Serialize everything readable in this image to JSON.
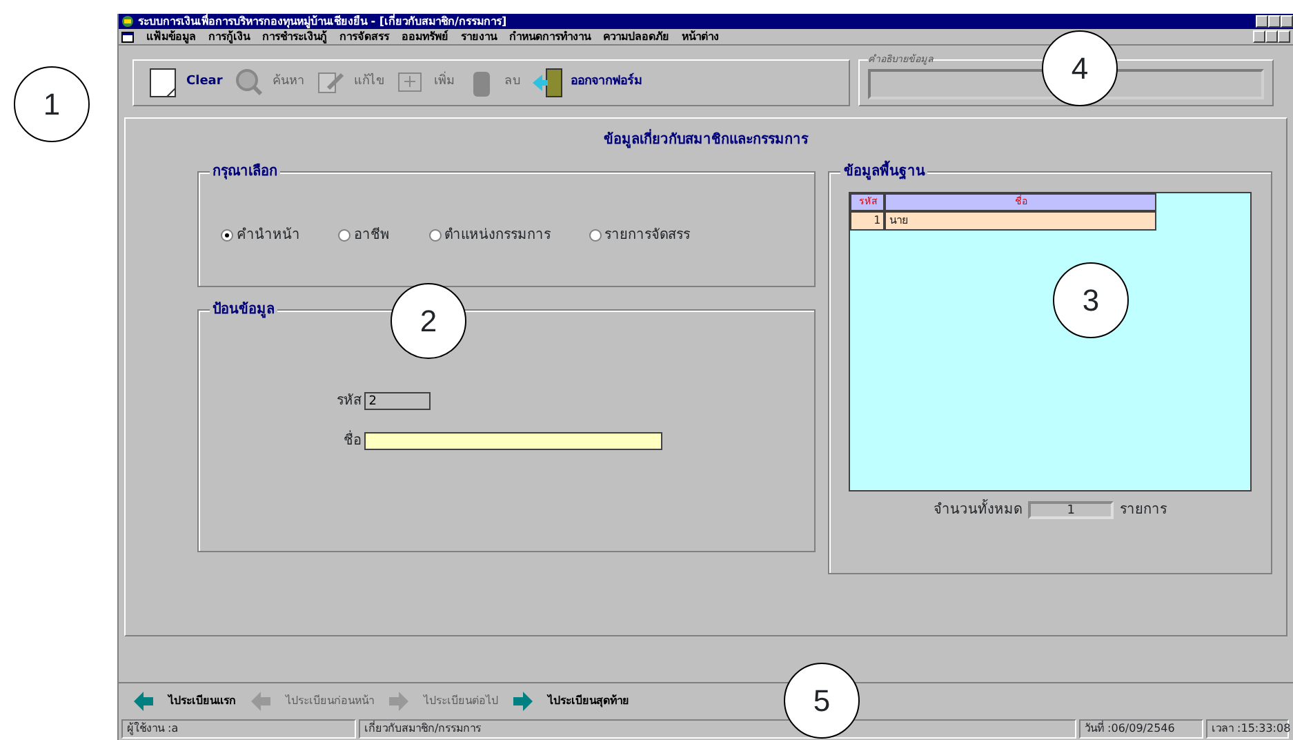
{
  "window": {
    "title": "ระบบการเงินเพื่อการบริหารกองทุนหมู่บ้านเชียงยืน - [เกี่ยวกับสมาชิก/กรรมการ]"
  },
  "menu": [
    "แฟ้มข้อมูล",
    "การกู้เงิน",
    "การชำระเงินกู้",
    "การจัดสรร",
    "ออมทรัพย์",
    "รายงาน",
    "กำหนดการทำงาน",
    "ความปลอดภัย",
    "หน้าต่าง"
  ],
  "toolbar": [
    {
      "kind": "clear",
      "label": "Clear",
      "disabled": false
    },
    {
      "kind": "search",
      "label": "ค้นหา",
      "disabled": true
    },
    {
      "kind": "edit",
      "label": "แก้ไข",
      "disabled": true
    },
    {
      "kind": "add",
      "label": "เพิ่ม",
      "disabled": true
    },
    {
      "kind": "delete",
      "label": "ลบ",
      "disabled": true
    },
    {
      "kind": "exit",
      "label": "ออกจากฟอร์ม",
      "disabled": false
    }
  ],
  "description_box": {
    "label": "คำอธิบายข้อมูล"
  },
  "heading": "ข้อมูลเกี่ยวกับสมาชิกและกรรมการ",
  "choice_group": {
    "title": "กรุณาเลือก",
    "options": [
      {
        "label": "คำนำหน้า",
        "selected": true
      },
      {
        "label": "อาชีพ",
        "selected": false
      },
      {
        "label": "ตำแหน่งกรรมการ",
        "selected": false
      },
      {
        "label": "รายการจัดสรร",
        "selected": false
      }
    ]
  },
  "input_group": {
    "title": "ป้อนข้อมูล",
    "fields": [
      {
        "label": "รหัส",
        "value": "2"
      },
      {
        "label": "ชื่อ"
      }
    ]
  },
  "data_group": {
    "title": "ข้อมูลพื้นฐาน",
    "columns": [
      "รหัส",
      "ชื่อ"
    ],
    "rows": [
      [
        "1",
        "นาย"
      ]
    ],
    "total_label": "จำนวนทั้งหมด",
    "total": "1",
    "unit": "รายการ"
  },
  "record_nav": [
    {
      "kind": "first",
      "label": "ไประเบียนแรก",
      "disabled": false
    },
    {
      "kind": "prev",
      "label": "ไประเบียนก่อนหน้า",
      "disabled": true
    },
    {
      "kind": "next",
      "label": "ไประเบียนต่อไป",
      "disabled": true
    },
    {
      "kind": "last",
      "label": "ไประเบียนสุดท้าย",
      "disabled": false
    }
  ],
  "status_bar": [
    "ผู้ใช้งาน :a",
    "เกี่ยวกับสมาชิก/กรรมการ",
    "วันที่ :06/09/2546",
    "เวลา :15:33:08"
  ],
  "callouts": [
    "1",
    "2",
    "3",
    "4",
    "5"
  ]
}
